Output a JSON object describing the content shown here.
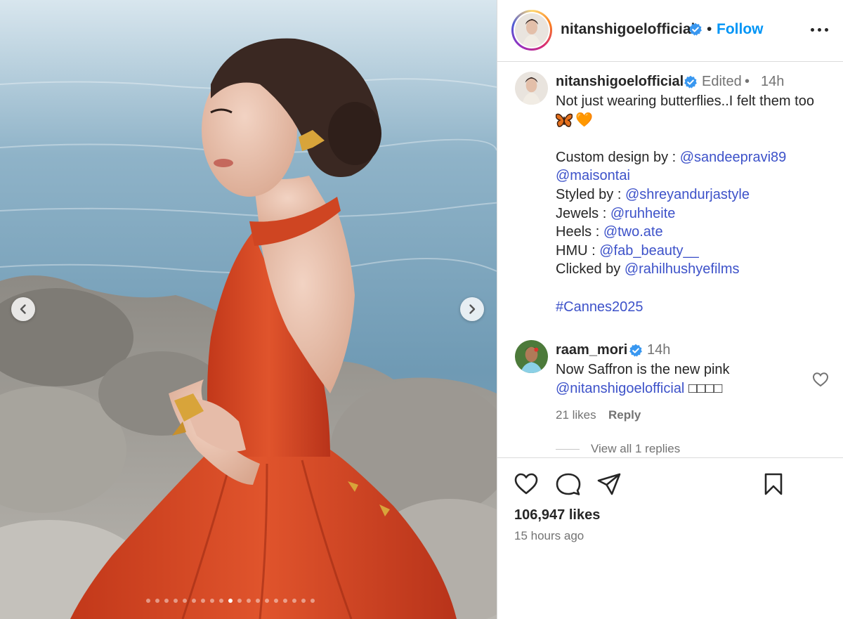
{
  "header": {
    "username": "nitanshigoelofficial",
    "separator": "•",
    "follow_label": "Follow"
  },
  "caption": {
    "username": "nitanshigoelofficial",
    "edited_label": "Edited",
    "dot": "•",
    "time": "14h",
    "lines": {
      "line1": "Not just wearing butterflies..I felt them too",
      "emoji": "🧡",
      "design_prefix": "Custom design by : ",
      "design_tag1": "@sandeepravi89",
      "design_tag2": "@maisontai",
      "styled_prefix": "Styled by : ",
      "styled_tag": "@shreyandurjastyle",
      "jewels_prefix": "Jewels : ",
      "jewels_tag": "@ruhheite",
      "heels_prefix": "Heels : ",
      "heels_tag": "@two.ate",
      "hmu_prefix": "HMU : ",
      "hmu_tag": "@fab_beauty__",
      "clicked_prefix": "Clicked by ",
      "clicked_tag": "@rahilhushyefilms",
      "hashtag": "#Cannes2025"
    }
  },
  "comment": {
    "username": "raam_mori",
    "time": "14h",
    "text_line1": "Now Saffron is the new pink",
    "mention": "@nitanshigoelofficial",
    "trailing_glyphs": "□□□□",
    "likes": "21 likes",
    "reply_label": "Reply",
    "view_replies": "View all 1 replies"
  },
  "footer": {
    "likes": "106,947 likes",
    "time": "15 hours ago"
  },
  "carousel": {
    "count": 19,
    "active_index": 9
  },
  "colors": {
    "link": "#3d52c9",
    "follow": "#0095f6",
    "verified": "#3897f0",
    "dress": "#d9451f"
  },
  "icons": {
    "verified": "verified-badge-icon",
    "more": "more-options-icon",
    "prev": "chevron-left-icon",
    "next": "chevron-right-icon",
    "like": "heart-icon",
    "comment": "comment-bubble-icon",
    "share": "paper-plane-icon",
    "save": "bookmark-icon"
  }
}
